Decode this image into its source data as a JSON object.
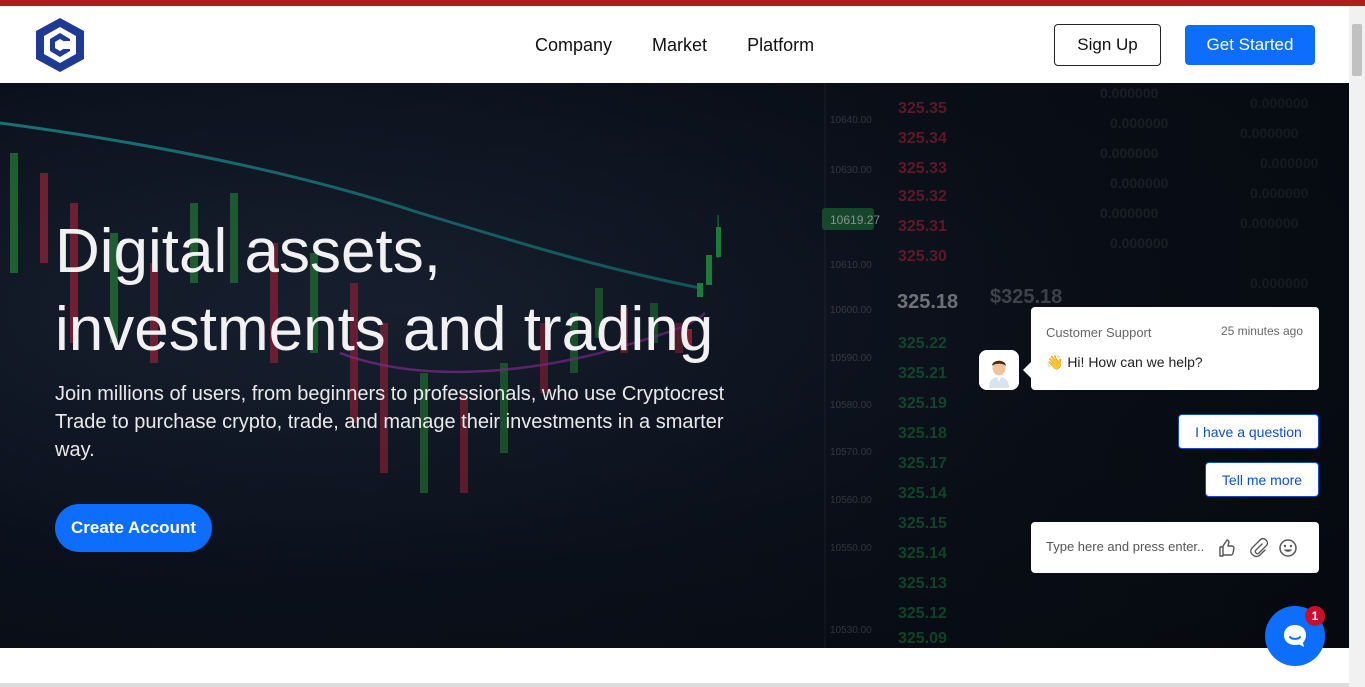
{
  "header": {
    "logo_icon": "cryptocrest-hexagon-logo",
    "nav": [
      "Company",
      "Market",
      "Platform"
    ],
    "signup_label": "Sign Up",
    "get_started_label": "Get Started"
  },
  "hero": {
    "title_line1": "Digital assets,",
    "title_line2": "investments and trading",
    "subtitle": "Join millions of users, from beginners to professionals, who use Cryptocrest Trade to purchase crypto, trade, and manage their investments in a smarter way.",
    "cta_label": "Create Account",
    "background": "crypto-candlestick-chart-image"
  },
  "chat": {
    "sender": "Customer Support",
    "time": "25 minutes ago",
    "message": "👋 Hi! How can we help?",
    "options": [
      "I have a question",
      "Tell me more"
    ],
    "input_placeholder": "Type here and press enter..",
    "icons": [
      "thumbs-up-icon",
      "paperclip-icon",
      "emoji-icon"
    ],
    "launcher_icon": "chat-bubble-icon",
    "unread_count": "1"
  },
  "colors": {
    "accent": "#0d6efd",
    "top_strip": "#b01d1d",
    "badge": "#c8102e"
  }
}
